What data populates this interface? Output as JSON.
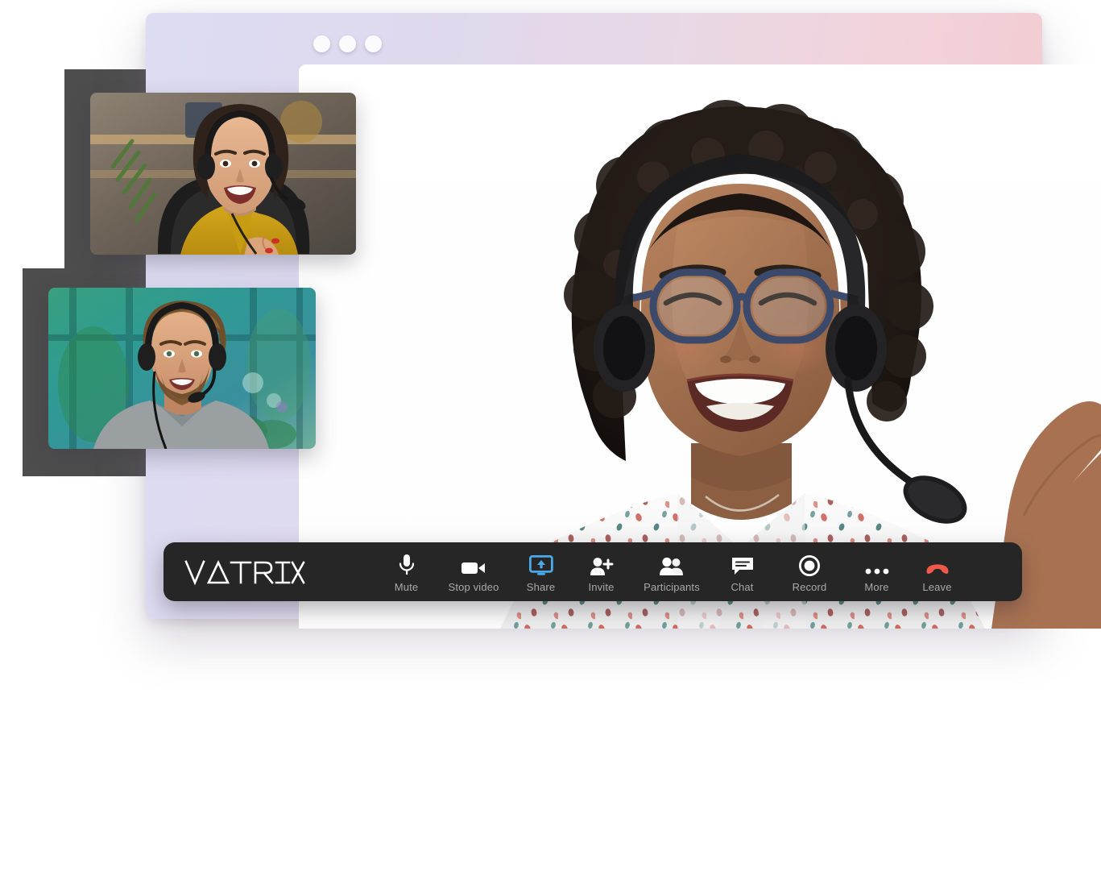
{
  "app": {
    "brand_name": "VATRIX",
    "window_controls": [
      {
        "name": "close",
        "color": "#fbfbfe"
      },
      {
        "name": "minimize",
        "color": "#fbfbfe"
      },
      {
        "name": "maximize",
        "color": "#fbfbfe"
      }
    ]
  },
  "theme": {
    "frame_gradient_start": "#dcdcf3",
    "frame_gradient_end": "#f3c9cd",
    "toolbar_bg": "#262626",
    "toolbar_label": "#a9a9a9",
    "accent_blue": "#4aa8e8",
    "leave_red": "#f2594a",
    "plate_gray": "#4d4d4d"
  },
  "toolbar": {
    "items": [
      {
        "id": "mute",
        "label": "Mute",
        "icon": "microphone-icon",
        "active": false
      },
      {
        "id": "stop-video",
        "label": "Stop video",
        "icon": "video-camera-icon",
        "active": false
      },
      {
        "id": "share",
        "label": "Share",
        "icon": "screen-share-icon",
        "active": true
      },
      {
        "id": "invite",
        "label": "Invite",
        "icon": "person-add-icon",
        "active": false
      },
      {
        "id": "participants",
        "label": "Participants",
        "icon": "people-icon",
        "active": false
      },
      {
        "id": "chat",
        "label": "Chat",
        "icon": "chat-bubble-icon",
        "active": false
      },
      {
        "id": "record",
        "label": "Record",
        "icon": "record-circle-icon",
        "active": false
      },
      {
        "id": "more",
        "label": "More",
        "icon": "ellipsis-icon",
        "active": false
      },
      {
        "id": "leave",
        "label": "Leave",
        "icon": "hang-up-icon",
        "active": false
      }
    ]
  },
  "video": {
    "main_speaker": {
      "name": "main-video-feed",
      "description": "Smiling woman with curly hair, glasses and headset"
    },
    "thumbnails": [
      {
        "name": "participant-thumbnail-1",
        "description": "Smiling woman in yellow shirt with headset"
      },
      {
        "name": "participant-thumbnail-2",
        "description": "Smiling man in gray shirt with headset"
      }
    ]
  }
}
